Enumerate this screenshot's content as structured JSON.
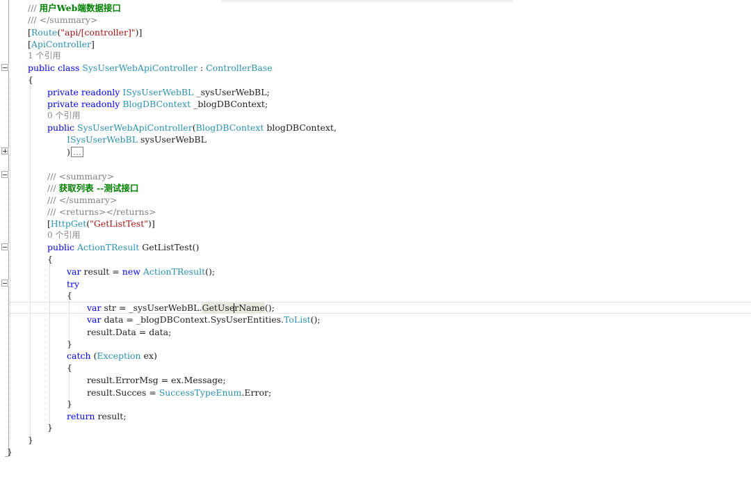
{
  "editor": {
    "lines": [
      {
        "id": "summary-text",
        "tokens": [
          {
            "cls": "cm",
            "text": "/// "
          },
          {
            "cls": "cg",
            "text": "用户Web端数据接口"
          }
        ]
      },
      {
        "id": "summary-end",
        "tokens": [
          {
            "cls": "cm",
            "text": "/// </summary>"
          }
        ]
      },
      {
        "id": "route-attr",
        "tokens": [
          {
            "cls": "p",
            "text": "["
          },
          {
            "cls": "t",
            "text": "Route"
          },
          {
            "cls": "p",
            "text": "("
          },
          {
            "cls": "s",
            "text": "\"api/[controller]\""
          },
          {
            "cls": "p",
            "text": ")]"
          }
        ]
      },
      {
        "id": "apicontroller-attr",
        "tokens": [
          {
            "cls": "p",
            "text": "["
          },
          {
            "cls": "t",
            "text": "ApiController"
          },
          {
            "cls": "p",
            "text": "]"
          }
        ]
      },
      {
        "id": "codelens-class",
        "tokens": [
          {
            "cls": "codelens",
            "text": "1 个引用"
          }
        ]
      },
      {
        "id": "class-decl",
        "tokens": [
          {
            "cls": "k",
            "text": "public class "
          },
          {
            "cls": "t",
            "text": "SysUserWebApiController"
          },
          {
            "cls": "p",
            "text": " : "
          },
          {
            "cls": "t",
            "text": "ControllerBase"
          }
        ]
      },
      {
        "id": "class-open",
        "tokens": [
          {
            "cls": "p",
            "text": "{"
          }
        ]
      },
      {
        "id": "field-bl",
        "tokens": [
          {
            "cls": "k",
            "text": "private readonly "
          },
          {
            "cls": "t",
            "text": "ISysUserWebBL"
          },
          {
            "cls": "p",
            "text": " _sysUserWebBL;"
          }
        ]
      },
      {
        "id": "field-db",
        "tokens": [
          {
            "cls": "k",
            "text": "private readonly "
          },
          {
            "cls": "t",
            "text": "BlogDBContext"
          },
          {
            "cls": "p",
            "text": " _blogDBContext;"
          }
        ]
      },
      {
        "id": "codelens-ctor",
        "tokens": [
          {
            "cls": "codelens",
            "text": "0 个引用"
          }
        ]
      },
      {
        "id": "ctor-decl",
        "tokens": [
          {
            "cls": "k",
            "text": "public "
          },
          {
            "cls": "t",
            "text": "SysUserWebApiController"
          },
          {
            "cls": "p",
            "text": "("
          },
          {
            "cls": "t",
            "text": "BlogDBContext"
          },
          {
            "cls": "p",
            "text": " blogDBContext,"
          }
        ]
      },
      {
        "id": "ctor-param2",
        "tokens": [
          {
            "cls": "t",
            "text": "ISysUserWebBL"
          },
          {
            "cls": "p",
            "text": " sysUserWebBL"
          }
        ]
      },
      {
        "id": "ctor-collapsed",
        "tokens": [
          {
            "cls": "p",
            "text": ")"
          },
          {
            "cls": "collapsed",
            "text": "..."
          }
        ]
      },
      {
        "id": "doc-summary-start",
        "tokens": [
          {
            "cls": "cm",
            "text": "/// <summary>"
          }
        ]
      },
      {
        "id": "doc-summary-text",
        "tokens": [
          {
            "cls": "cm",
            "text": "/// "
          },
          {
            "cls": "cg",
            "text": "获取列表 --测试接口"
          }
        ]
      },
      {
        "id": "doc-summary-end",
        "tokens": [
          {
            "cls": "cm",
            "text": "/// </summary>"
          }
        ]
      },
      {
        "id": "doc-returns",
        "tokens": [
          {
            "cls": "cm",
            "text": "/// <returns></returns>"
          }
        ]
      },
      {
        "id": "httpget-attr",
        "tokens": [
          {
            "cls": "p",
            "text": "["
          },
          {
            "cls": "t",
            "text": "HttpGet"
          },
          {
            "cls": "p",
            "text": "("
          },
          {
            "cls": "s",
            "text": "\"GetListTest\""
          },
          {
            "cls": "p",
            "text": ")]"
          }
        ]
      },
      {
        "id": "codelens-method",
        "tokens": [
          {
            "cls": "codelens",
            "text": "0 个引用"
          }
        ]
      },
      {
        "id": "method-decl",
        "tokens": [
          {
            "cls": "k",
            "text": "public "
          },
          {
            "cls": "t",
            "text": "ActionTResult"
          },
          {
            "cls": "p",
            "text": " GetListTest()"
          }
        ]
      },
      {
        "id": "method-open",
        "tokens": [
          {
            "cls": "p",
            "text": "{"
          }
        ]
      },
      {
        "id": "var-result",
        "tokens": [
          {
            "cls": "k",
            "text": "var"
          },
          {
            "cls": "p",
            "text": " result = "
          },
          {
            "cls": "k",
            "text": "new "
          },
          {
            "cls": "t",
            "text": "ActionTResult"
          },
          {
            "cls": "p",
            "text": "();"
          }
        ]
      },
      {
        "id": "try-keyword",
        "tokens": [
          {
            "cls": "k",
            "text": "try"
          }
        ]
      },
      {
        "id": "try-open",
        "tokens": [
          {
            "cls": "p",
            "text": "{"
          }
        ]
      },
      {
        "id": "var-str",
        "tokens": [
          {
            "cls": "k",
            "text": "var"
          },
          {
            "cls": "p",
            "text": " str = _sysUserWebBL."
          },
          {
            "cls": "hl",
            "text": "GetUserName"
          },
          {
            "cls": "p",
            "text": "();"
          }
        ]
      },
      {
        "id": "var-data",
        "tokens": [
          {
            "cls": "k",
            "text": "var"
          },
          {
            "cls": "p",
            "text": " data = _blogDBContext.SysUserEntities."
          },
          {
            "cls": "t",
            "text": "ToList"
          },
          {
            "cls": "p",
            "text": "();"
          }
        ]
      },
      {
        "id": "assign-data",
        "tokens": [
          {
            "cls": "p",
            "text": "result.Data = data;"
          }
        ]
      },
      {
        "id": "try-close",
        "tokens": [
          {
            "cls": "p",
            "text": "}"
          }
        ]
      },
      {
        "id": "catch-keyword",
        "tokens": [
          {
            "cls": "k",
            "text": "catch"
          },
          {
            "cls": "p",
            "text": " ("
          },
          {
            "cls": "t",
            "text": "Exception"
          },
          {
            "cls": "p",
            "text": " ex)"
          }
        ]
      },
      {
        "id": "catch-open",
        "tokens": [
          {
            "cls": "p",
            "text": "{"
          }
        ]
      },
      {
        "id": "assign-errormsg",
        "tokens": [
          {
            "cls": "p",
            "text": "result.ErrorMsg = ex.Message;"
          }
        ]
      },
      {
        "id": "assign-succes",
        "tokens": [
          {
            "cls": "p",
            "text": "result.Succes = "
          },
          {
            "cls": "t",
            "text": "SuccessTypeEnum"
          },
          {
            "cls": "p",
            "text": ".Error;"
          }
        ]
      },
      {
        "id": "catch-close",
        "tokens": [
          {
            "cls": "p",
            "text": "}"
          }
        ]
      },
      {
        "id": "return-result",
        "tokens": [
          {
            "cls": "k",
            "text": "return"
          },
          {
            "cls": "p",
            "text": " result;"
          }
        ]
      },
      {
        "id": "method-close",
        "tokens": [
          {
            "cls": "p",
            "text": "}"
          }
        ]
      },
      {
        "id": "class-close",
        "tokens": [
          {
            "cls": "p",
            "text": "}"
          }
        ]
      },
      {
        "id": "namespace-close",
        "tokens": [
          {
            "cls": "p",
            "text": "}"
          }
        ]
      }
    ]
  }
}
